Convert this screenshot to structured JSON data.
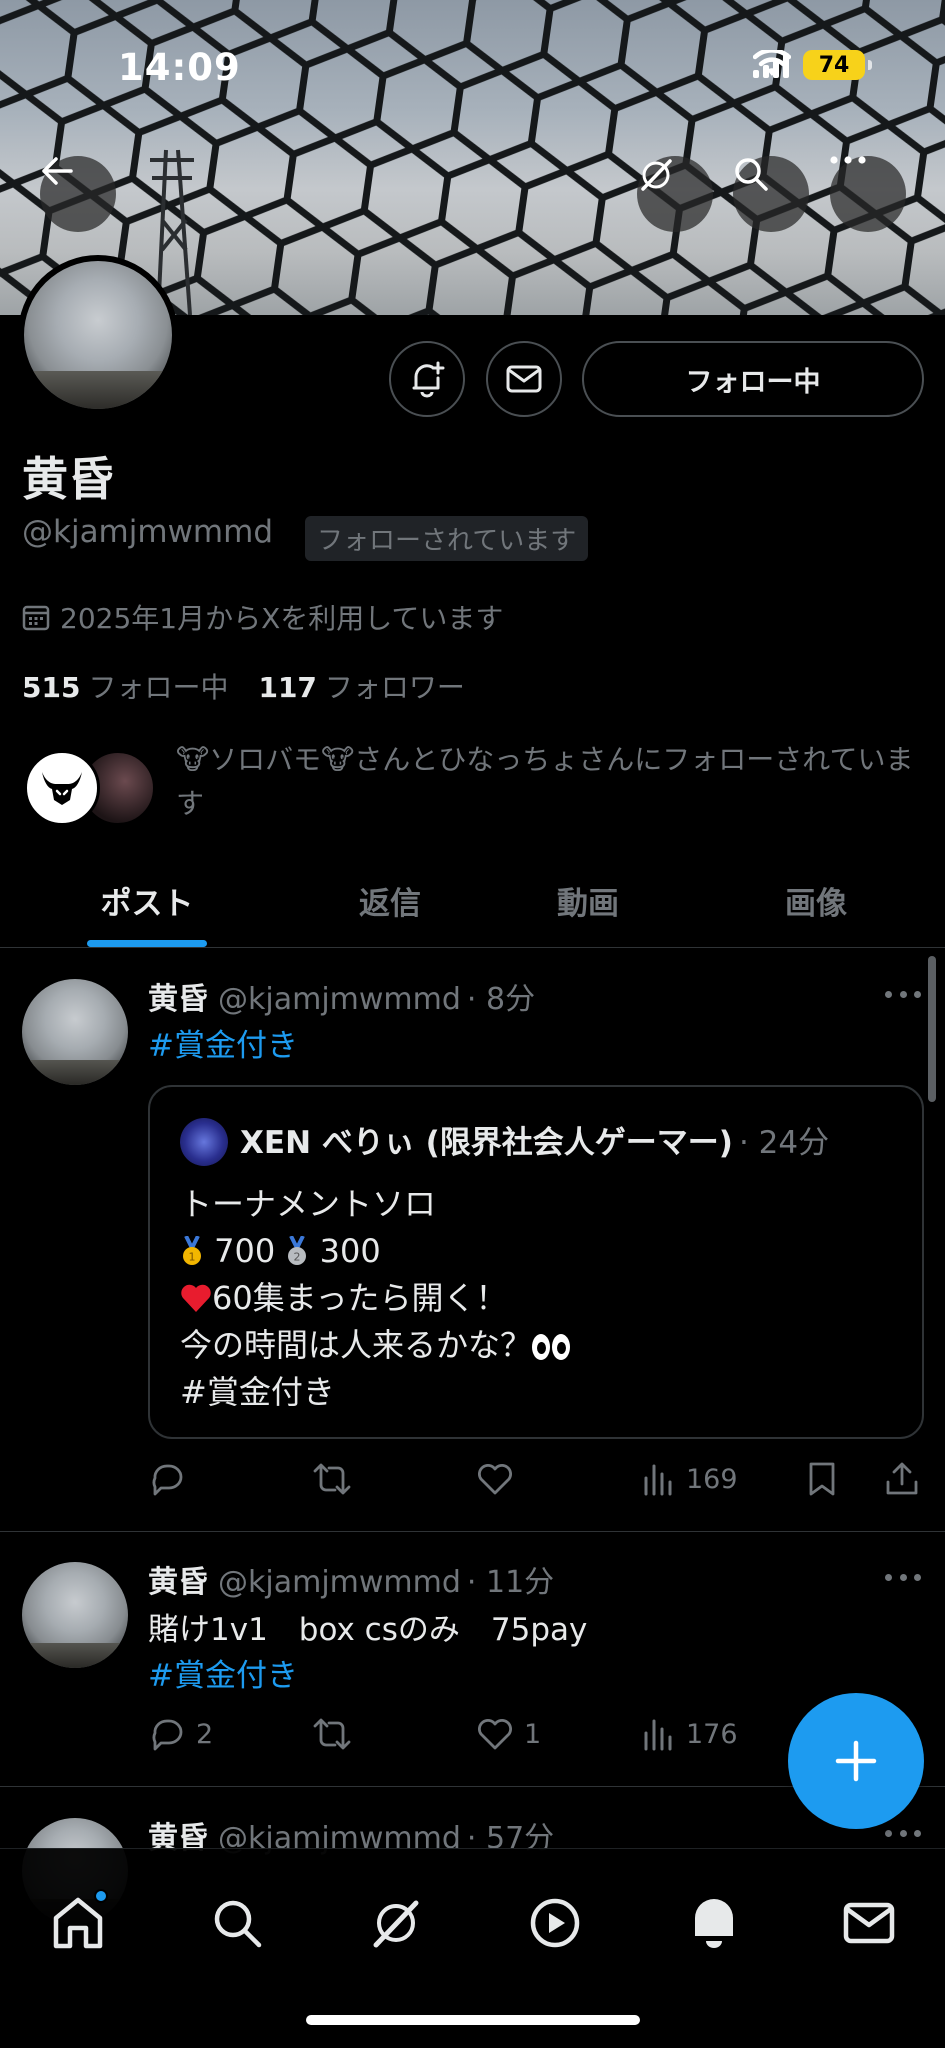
{
  "status_bar": {
    "time": "14:09",
    "battery": "74"
  },
  "profile": {
    "name": "黄昏",
    "handle": "@kjamjmwmmd",
    "follows_you_badge": "フォローされています",
    "joined": "2025年1月からXを利用しています",
    "following_count": "515",
    "following_label": "フォロー中",
    "followers_count": "117",
    "followers_label": "フォロワー",
    "mutual_text": "🐮ソロバモ🐮さんとひなっちょさんにフォローされています",
    "follow_button": "フォロー中"
  },
  "tabs": [
    {
      "label": "ポスト",
      "active": true
    },
    {
      "label": "返信",
      "active": false
    },
    {
      "label": "動画",
      "active": false
    },
    {
      "label": "画像",
      "active": false
    }
  ],
  "posts": [
    {
      "name": "黄昏",
      "handle": "@kjamjmwmmd",
      "time": "· 8分",
      "hashtag": "#賞金付き",
      "quote": {
        "name": "XEN べりぃ (限界社会人ゲーマー)",
        "time": "· 24分",
        "line1": "トーナメントソロ",
        "line2_first": "700",
        "line2_second": "300",
        "line3": "60集まったら開く！",
        "line4": "今の時間は人来るかな？",
        "line5": "#賞金付き"
      },
      "views": "169"
    },
    {
      "name": "黄昏",
      "handle": "@kjamjmwmmd",
      "time": "· 11分",
      "text": "賭け1v1　box  csのみ　75pay",
      "hashtag": "#賞金付き",
      "replies": "2",
      "likes": "1",
      "views": "176"
    },
    {
      "name": "黄昏",
      "handle": "@kjamjmwmmd",
      "time": "· 57分"
    }
  ],
  "colors": {
    "accent": "#1d9bf0",
    "muted": "#71767b",
    "background": "#000000",
    "battery": "#f7d21a"
  },
  "icons": {
    "banner": [
      "back-icon",
      "grok-icon",
      "search-icon",
      "more-icon"
    ],
    "profile": [
      "notification-add-icon",
      "message-icon",
      "calendar-icon"
    ],
    "post_actions": [
      "reply-icon",
      "repost-icon",
      "like-icon",
      "views-icon",
      "bookmark-icon",
      "share-icon"
    ],
    "nav": [
      "home-icon",
      "search-icon",
      "grok-icon",
      "video-icon",
      "notifications-icon",
      "messages-icon"
    ]
  }
}
